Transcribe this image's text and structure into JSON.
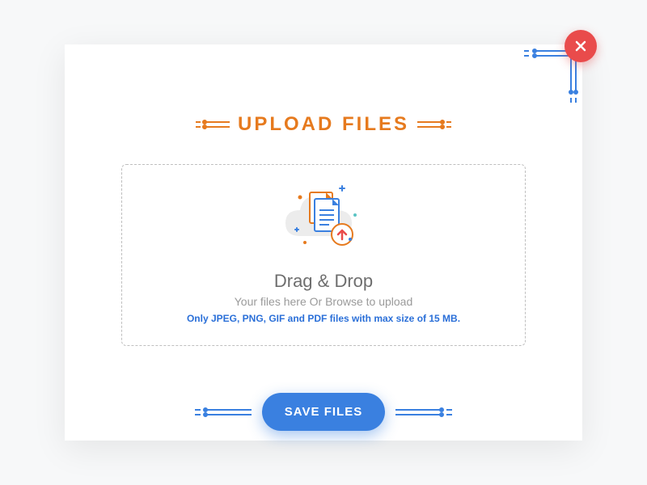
{
  "colors": {
    "accent_orange": "#e67a1e",
    "accent_blue": "#3a80e0",
    "close_red": "#e94b4b",
    "hint_blue": "#2a6fd8"
  },
  "header": {
    "title": "UPLOAD FILES"
  },
  "dropzone": {
    "heading": "Drag & Drop",
    "subtext": "Your files here Or Browse to upload",
    "hint": "Only JPEG, PNG, GIF and PDF files with max size of 15 MB."
  },
  "actions": {
    "save_label": "SAVE FILES",
    "close_label": "Close"
  }
}
